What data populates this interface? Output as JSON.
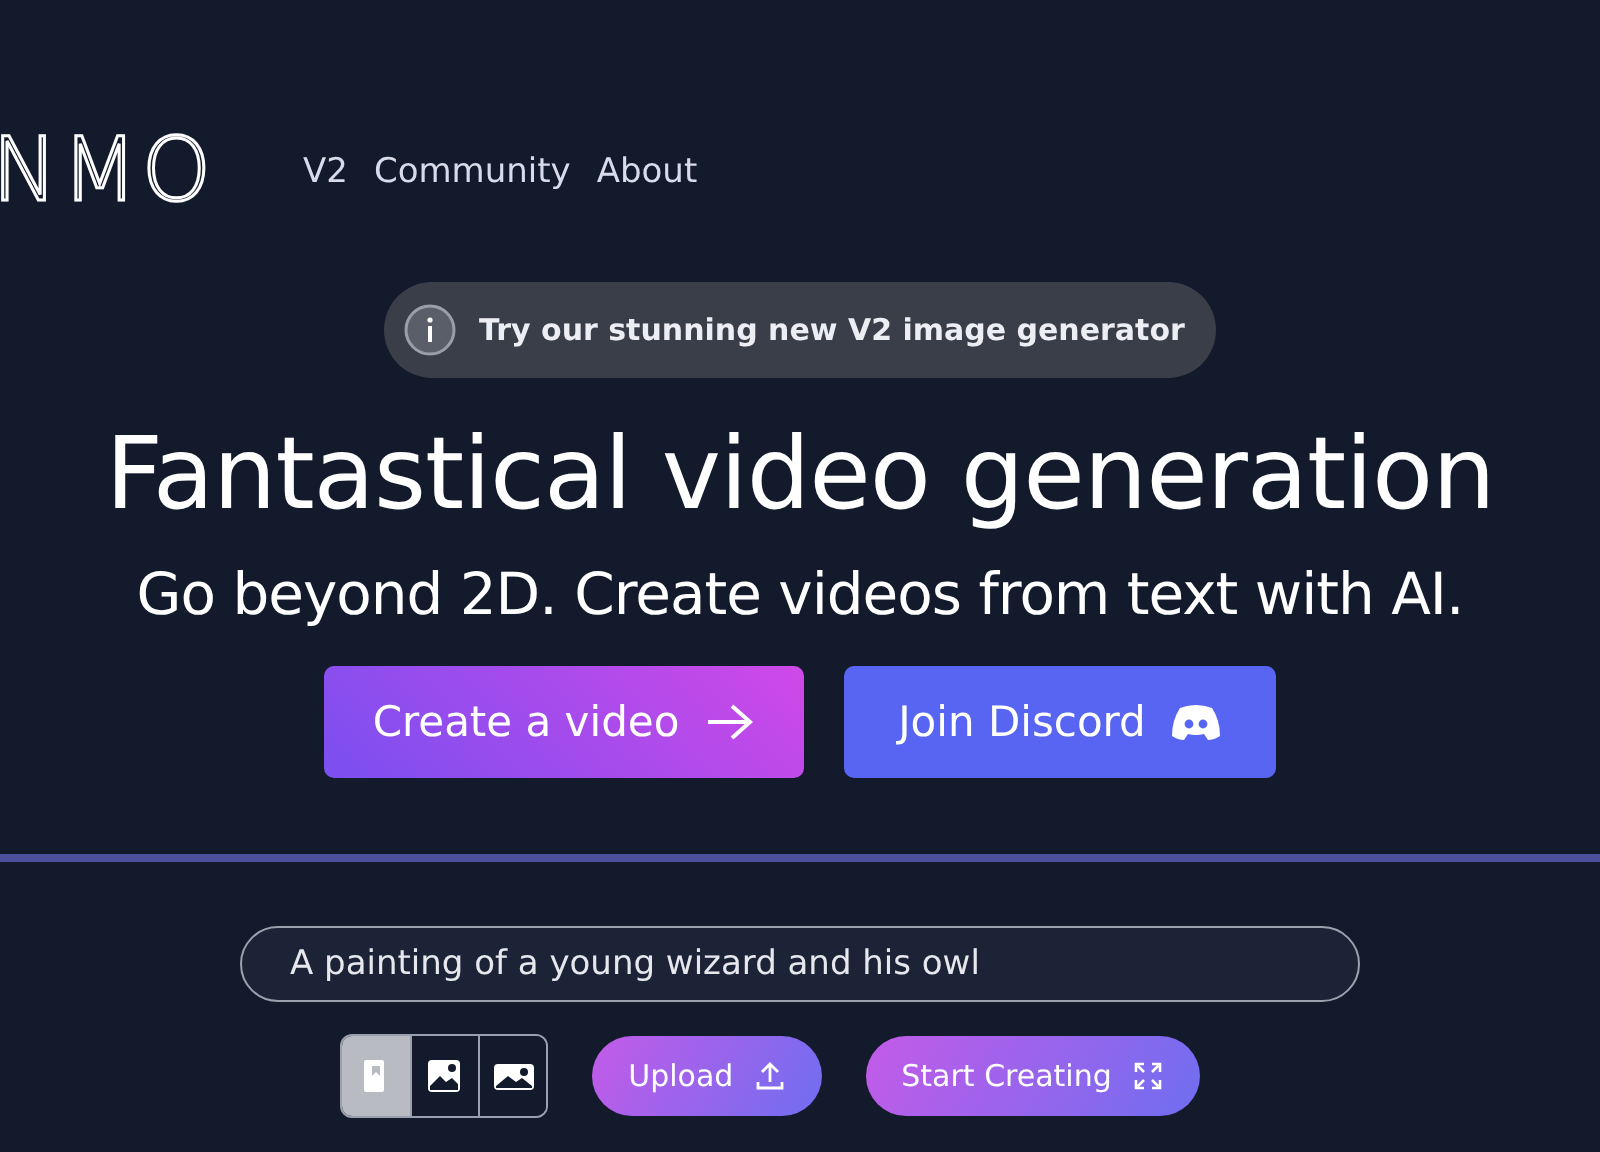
{
  "header": {
    "logo": "NMO",
    "nav": [
      {
        "label": "V2"
      },
      {
        "label": "Community"
      },
      {
        "label": "About"
      }
    ]
  },
  "announcement": {
    "text": "Try our stunning new V2 image generator"
  },
  "hero": {
    "title": "Fantastical video generation",
    "subtitle": "Go beyond 2D. Create videos from text with AI."
  },
  "actions": [
    {
      "label": "Create a video",
      "kind": "primary"
    },
    {
      "label": "Join Discord",
      "kind": "discord"
    }
  ],
  "prompt": {
    "value": "A painting of a young wizard and his owl"
  },
  "aspect_options": [
    {
      "kind": "portrait",
      "selected": true
    },
    {
      "kind": "square",
      "selected": false
    },
    {
      "kind": "landscape",
      "selected": false
    }
  ],
  "tools": [
    {
      "label": "Upload",
      "kind": "upload"
    },
    {
      "label": "Start Creating",
      "kind": "expand"
    }
  ]
}
